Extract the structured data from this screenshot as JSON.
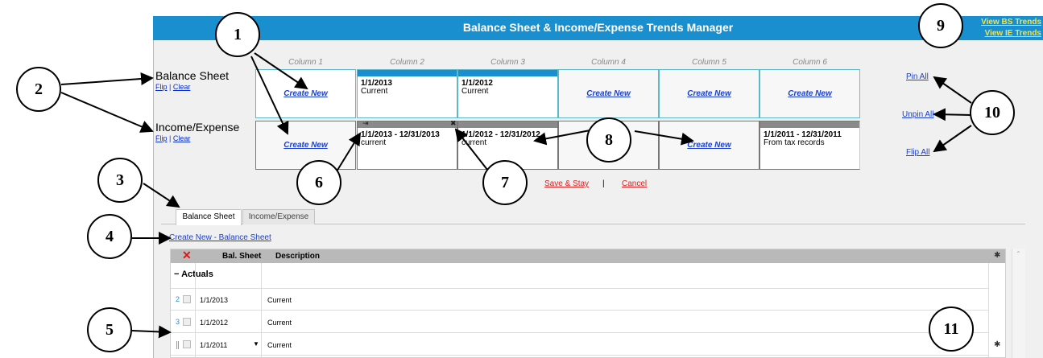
{
  "app": {
    "title": "Balance Sheet & Income/Expense Trends Manager",
    "view_bs": "View BS Trends",
    "view_ie": "View IE Trends"
  },
  "columns": [
    "Column 1",
    "Column 2",
    "Column 3",
    "Column 4",
    "Column 5",
    "Column 6"
  ],
  "balance_sheet": {
    "label": "Balance Sheet",
    "flip": "Flip",
    "sep": "|",
    "clear": "Clear",
    "cells": [
      {
        "type": "create",
        "text": "Create New"
      },
      {
        "type": "data",
        "line1": "1/1/2013",
        "line2": "Current"
      },
      {
        "type": "data",
        "line1": "1/1/2012",
        "line2": "Current"
      },
      {
        "type": "create",
        "text": "Create New"
      },
      {
        "type": "create",
        "text": "Create New"
      },
      {
        "type": "create",
        "text": "Create New"
      }
    ]
  },
  "income_expense": {
    "label": "Income/Expense",
    "flip": "Flip",
    "sep": "|",
    "clear": "Clear",
    "cells": [
      {
        "type": "create",
        "text": "Create New"
      },
      {
        "type": "data",
        "line1": "1/1/2013 - 12/31/2013",
        "line2": "current"
      },
      {
        "type": "data",
        "line1": "1/1/2012 - 12/31/2012",
        "line2": "current"
      },
      {
        "type": "create",
        "text": "Create New"
      },
      {
        "type": "empty"
      },
      {
        "type": "data",
        "line1": "1/1/2011 - 12/31/2011",
        "line2": "From tax records"
      }
    ]
  },
  "side_links": {
    "pin_all": "Pin All",
    "unpin_all": "Unpin All",
    "flip_all": "Flip All"
  },
  "actions": {
    "save": "Save & Stay",
    "sep": "|",
    "cancel": "Cancel"
  },
  "tabs": [
    "Balance Sheet",
    "Income/Expense"
  ],
  "create_new_bs": "Create New - Balance Sheet",
  "grid": {
    "delete_icon": "✕",
    "col_balsheet": "Bal. Sheet",
    "col_description": "Description",
    "group_label": "Actuals",
    "group_toggle": "−",
    "rows": [
      {
        "num": "2",
        "date": "1/1/2013",
        "desc": "Current"
      },
      {
        "num": "3",
        "date": "1/1/2012",
        "desc": "Current"
      },
      {
        "num": "",
        "date": "1/1/2011",
        "desc": "Current"
      }
    ]
  },
  "callouts": [
    "1",
    "2",
    "3",
    "4",
    "5",
    "6",
    "7",
    "8",
    "9",
    "10",
    "11"
  ],
  "colors": {
    "title_bar": "#1a8fd0",
    "link": "#1a3fd0",
    "accent_red": "#e02020",
    "view_link": "#f3e24b"
  }
}
